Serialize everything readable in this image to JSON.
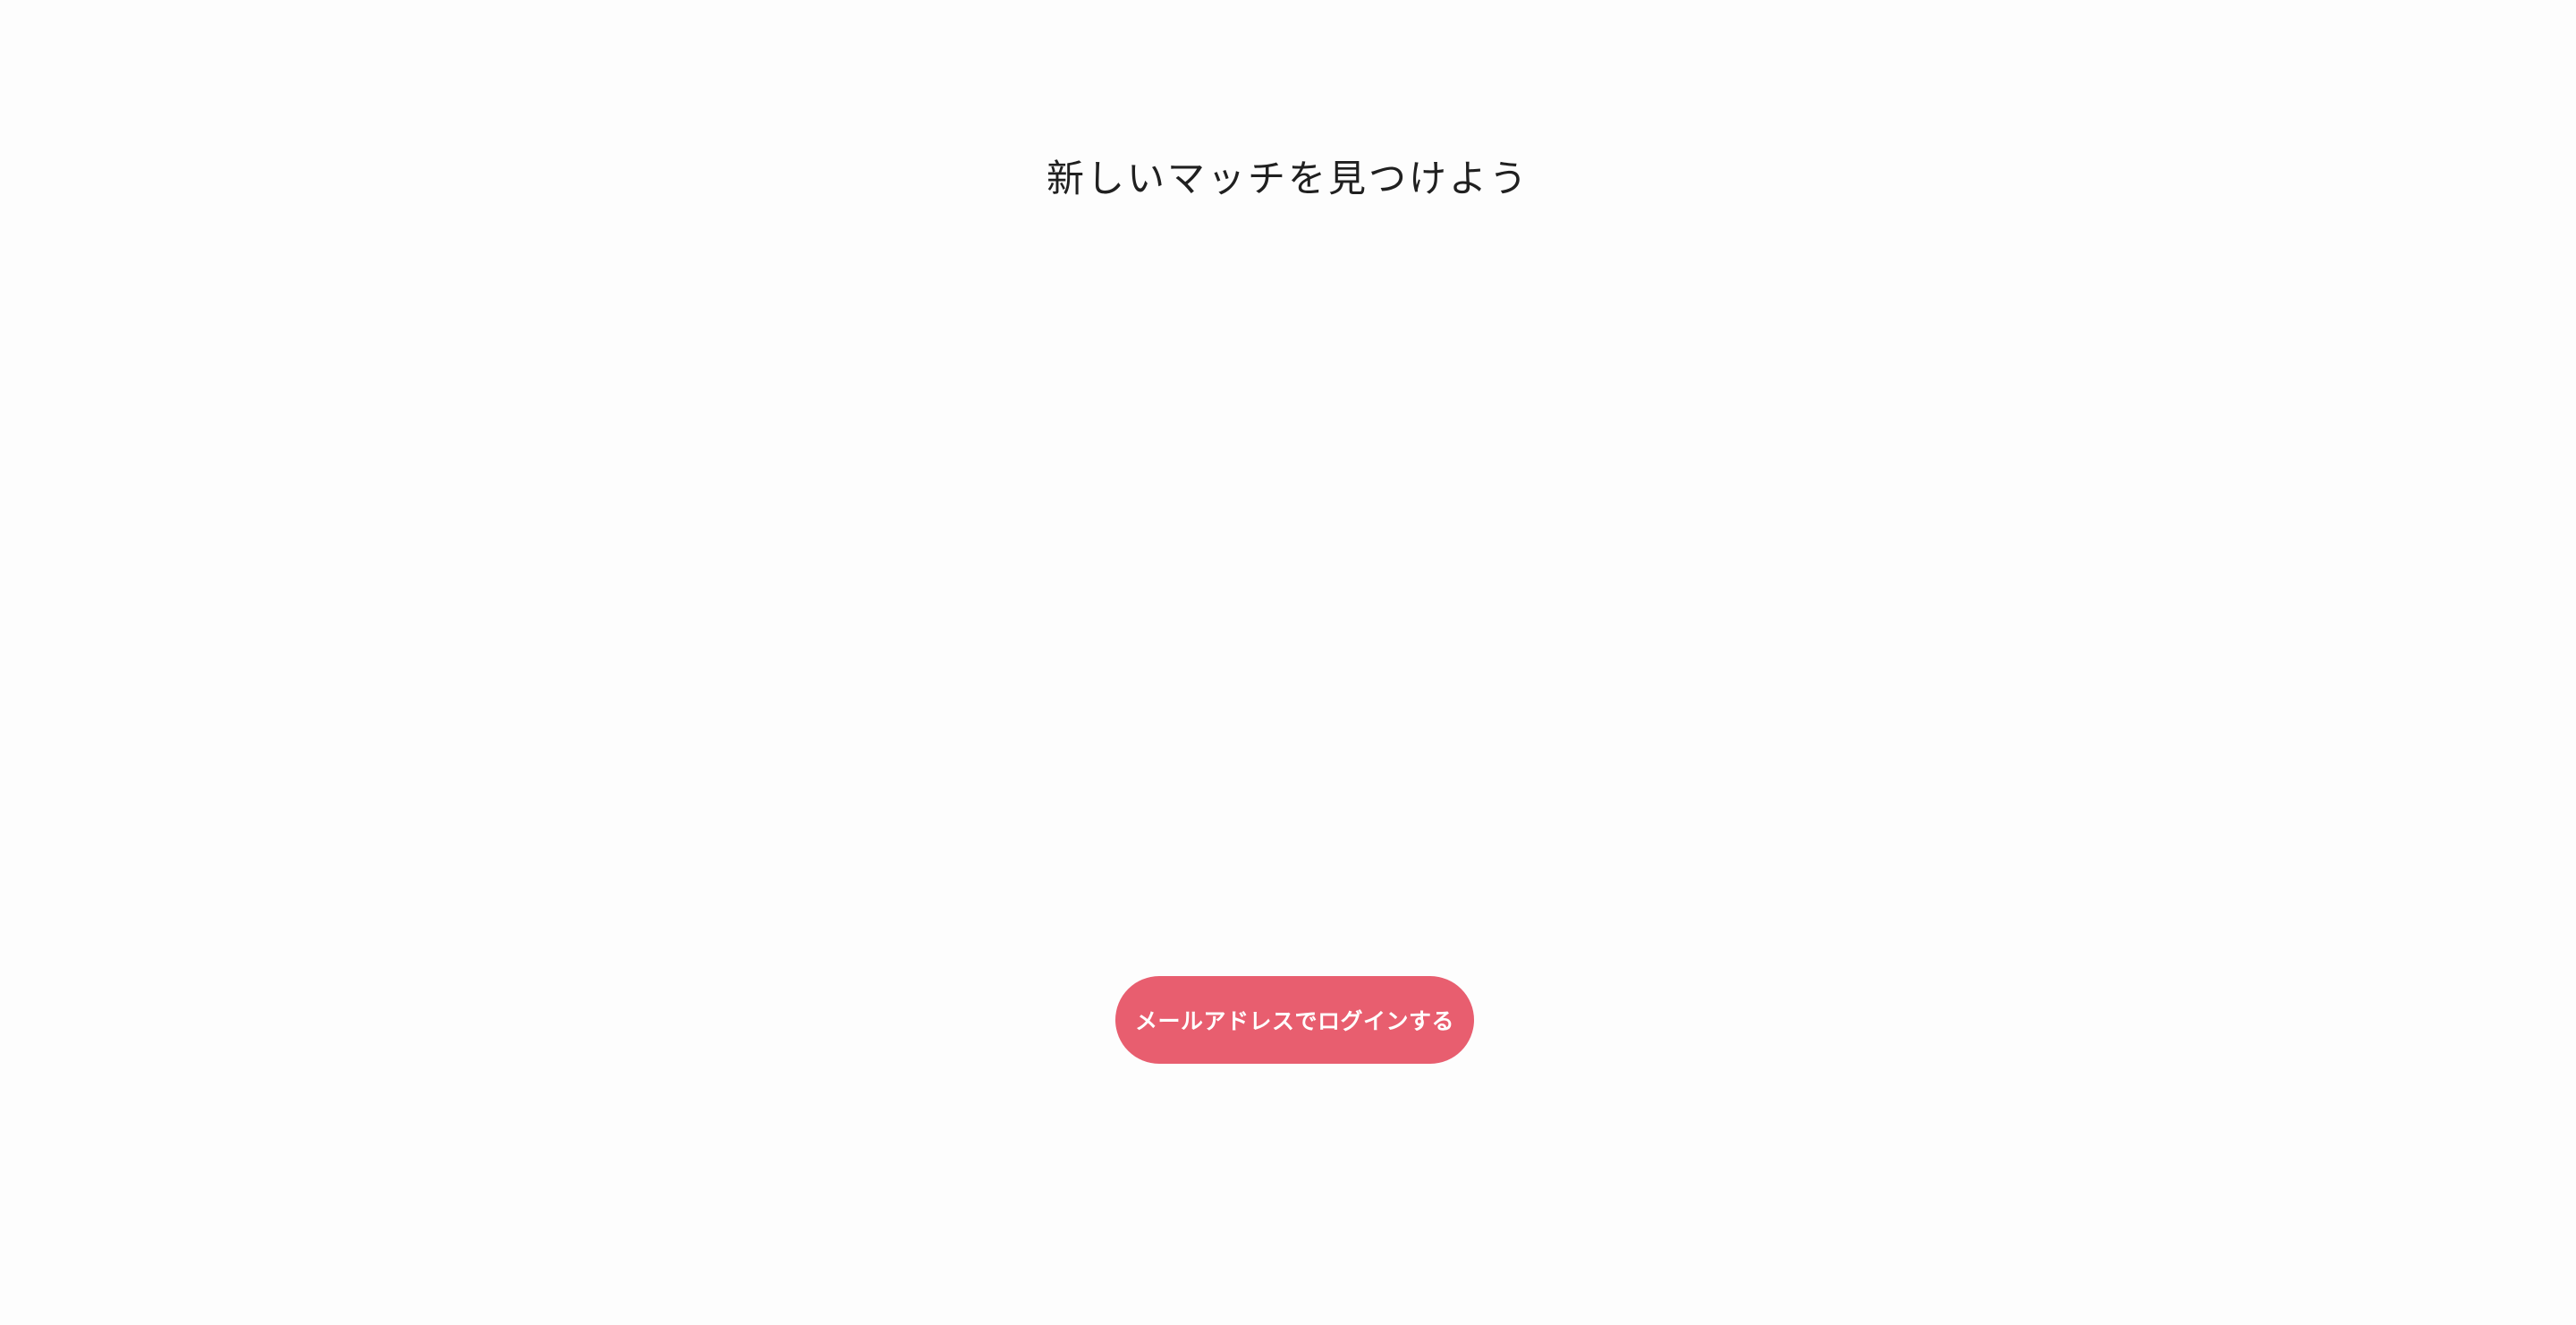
{
  "hero": {
    "headline": "新しいマッチを見つけよう"
  },
  "actions": {
    "email_login_label": "メールアドレスでログインする"
  },
  "colors": {
    "background": "#fdfdfd",
    "headline_text": "#202020",
    "primary_button": "#e85e6f",
    "primary_button_text": "#ffffff"
  }
}
